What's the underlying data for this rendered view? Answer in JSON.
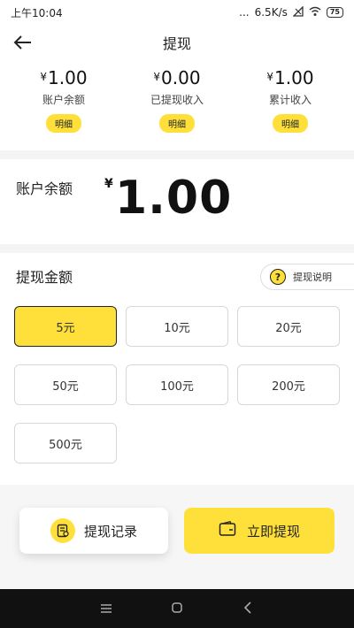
{
  "status": {
    "time": "上午10:04",
    "dots": "...",
    "speed": "6.5K/s",
    "battery": "75"
  },
  "appbar": {
    "title": "提现"
  },
  "summary": [
    {
      "currency": "¥",
      "value": "1.00",
      "label": "账户余额",
      "detail": "明细"
    },
    {
      "currency": "¥",
      "value": "0.00",
      "label": "已提现收入",
      "detail": "明细"
    },
    {
      "currency": "¥",
      "value": "1.00",
      "label": "累计收入",
      "detail": "明细"
    }
  ],
  "balance": {
    "label": "账户余额",
    "currency": "¥",
    "amount": "1.00"
  },
  "amounts": {
    "title": "提现金额",
    "help_label": "提现说明",
    "help_icon": "?",
    "options": [
      "5元",
      "10元",
      "20元",
      "50元",
      "100元",
      "200元",
      "500元"
    ],
    "selected": "5元"
  },
  "actions": {
    "record_label": "提现记录",
    "withdraw_label": "立即提现"
  },
  "colors": {
    "accent": "#ffe03b"
  }
}
